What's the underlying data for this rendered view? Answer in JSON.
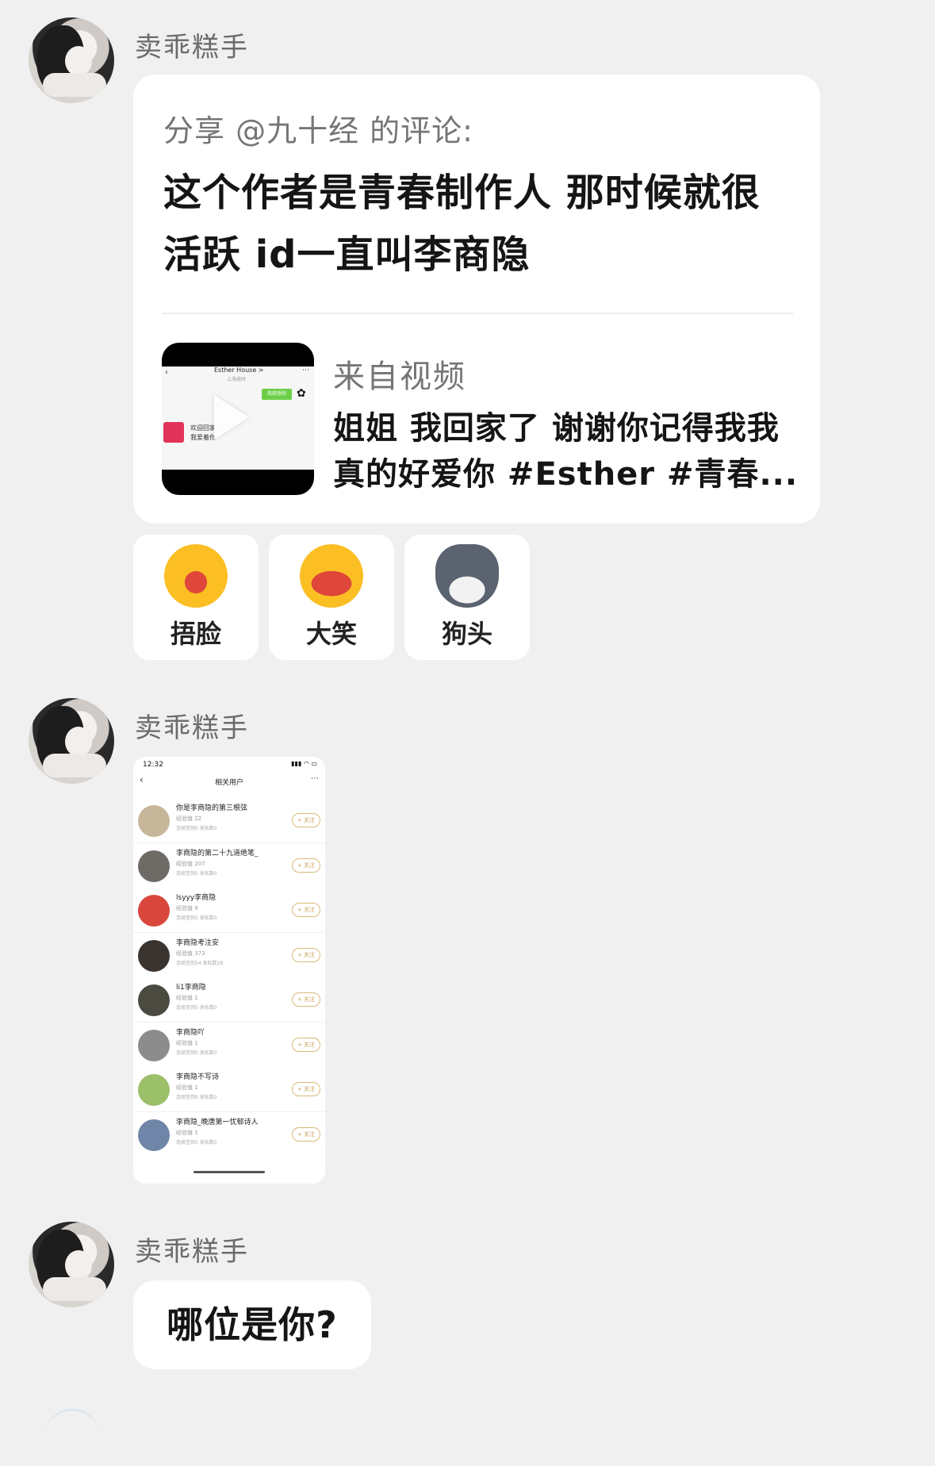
{
  "messages": [
    {
      "sender": "卖乖糕手",
      "share_card": {
        "prefix": "分享 @九十经 的评论:",
        "comment_line1": "这个作者是青春制作人 那时候就很",
        "comment_line2": "活跃 id一直叫李商隐",
        "from_label": "来自视频",
        "video_desc_line1": "姐姐 我回家了 谢谢你记得我我",
        "video_desc_line2": "真的好爱你 #Esther #青春...",
        "thumbnail": {
          "title": "Esther House >",
          "sub": "上海迪时",
          "tag": "我获想你",
          "left_text": "欢迎回家~",
          "left_text2": "我爱着你"
        }
      },
      "reactions": [
        {
          "label": "捂脸",
          "icon": "facepalm-emoji-icon",
          "color": "#fbbf24"
        },
        {
          "label": "大笑",
          "icon": "laugh-emoji-icon",
          "color": "#fbbf24"
        },
        {
          "label": "狗头",
          "icon": "dog-head-emoji-icon",
          "color": "#5b6270"
        }
      ]
    },
    {
      "sender": "卖乖糕手",
      "screenshot": {
        "time": "12:32",
        "title": "相关用户",
        "follow_label": "+ 关注",
        "users": [
          {
            "name": "你是李商隐的第三根弦",
            "exp": "经验值 22",
            "stats": "连续签到0  发帖数0",
            "color": "#c7b79a"
          },
          {
            "name": "李商隐的第二十九道绝笔_",
            "exp": "经验值 207",
            "stats": "连续签到0  发帖数0",
            "color": "#6e6a66"
          },
          {
            "name": "lsyyy李商隐",
            "exp": "经验值 9",
            "stats": "连续签到0  发帖数0",
            "color": "#d9473c"
          },
          {
            "name": "李商隐考注安",
            "exp": "经验值 373",
            "stats": "连续签到54  发帖数28",
            "color": "#3a3431"
          },
          {
            "name": "li1李商隐",
            "exp": "经验值 1",
            "stats": "连续签到0  发帖数0",
            "color": "#4b4a40"
          },
          {
            "name": "李商隐吖",
            "exp": "经验值 1",
            "stats": "连续签到0  发帖数0",
            "color": "#8c8c8c"
          },
          {
            "name": "李商隐不写诗",
            "exp": "经验值 1",
            "stats": "连续签到0  发帖数0",
            "color": "#9cbf6a"
          },
          {
            "name": "李商隐_晚唐第一忧郁诗人",
            "exp": "经验值 1",
            "stats": "连续签到0  发帖数0",
            "color": "#6f86a8"
          }
        ]
      }
    },
    {
      "sender": "卖乖糕手",
      "text": "哪位是你?"
    }
  ]
}
